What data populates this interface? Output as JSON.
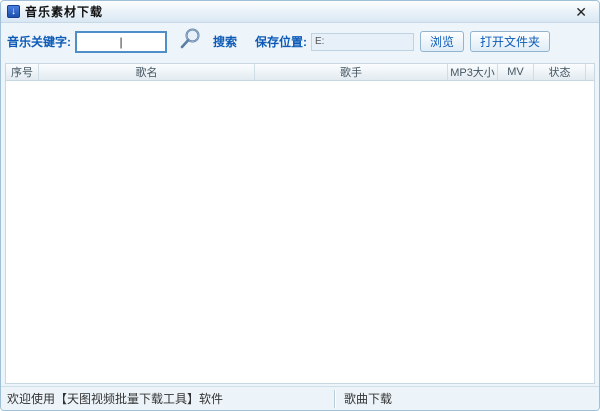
{
  "window": {
    "title": "音乐素材下载",
    "app_icon_glyph": "↓",
    "close_label": "✕"
  },
  "toolbar": {
    "keyword_label": "音乐关键字:",
    "keyword_value": "|",
    "search_label": "搜索",
    "save_location_label": "保存位置:",
    "save_path_value": "E:",
    "browse_button": "浏览",
    "open_folder_button": "打开文件夹"
  },
  "table": {
    "columns": [
      "序号",
      "歌名",
      "歌手",
      "MP3大小",
      "MV",
      "状态"
    ],
    "rows": []
  },
  "status_bar": {
    "left": "欢迎使用【天图视频批量下载工具】软件",
    "right": "歌曲下载"
  },
  "colors": {
    "accent_blue": "#0d5bb7",
    "window_border": "#a0c0d8",
    "toolbar_bg": "#eef5fa",
    "header_text": "#445560"
  }
}
